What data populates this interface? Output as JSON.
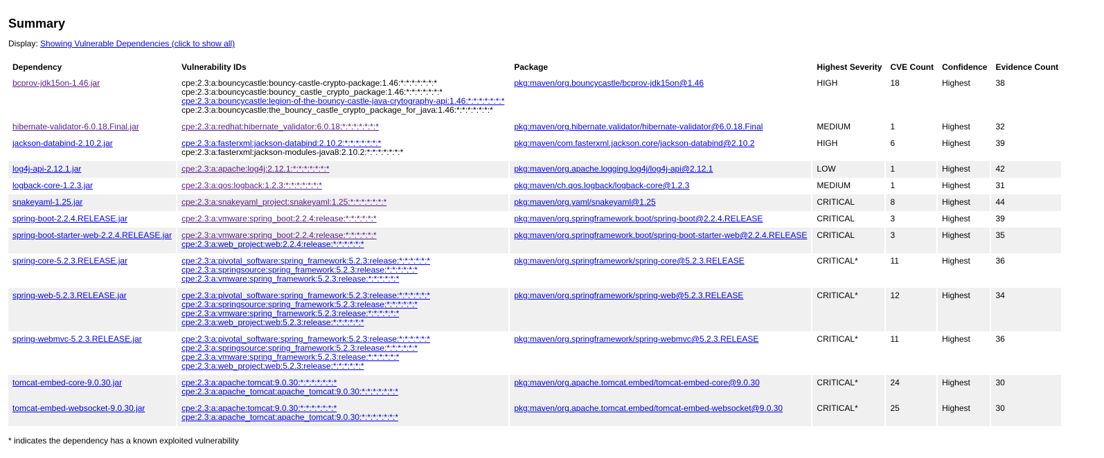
{
  "title": "Summary",
  "display": {
    "label": "Display:",
    "link": "Showing Vulnerable Dependencies (click to show all)"
  },
  "table": {
    "headers": [
      "Dependency",
      "Vulnerability IDs",
      "Package",
      "Highest Severity",
      "CVE Count",
      "Confidence",
      "Evidence Count"
    ],
    "rows": [
      {
        "dependency": "bcprov-jdk15on-1.46.jar",
        "visited": true,
        "ids": [
          {
            "text": "cpe:2.3:a:bouncycastle:bouncy-castle-crypto-package:1.46:*:*:*:*:*:*:*",
            "link": false
          },
          {
            "text": "cpe:2.3:a:bouncycastle:bouncy_castle_crypto_package:1.46:*:*:*:*:*:*:*",
            "link": false
          },
          {
            "text": "cpe:2.3:a:bouncycastle:legion-of-the-bouncy-castle-java-crytography-api:1.46:*:*:*:*:*:*:*",
            "link": true
          },
          {
            "text": "cpe:2.3:a:bouncycastle:the_bouncy_castle_crypto_package_for_java:1.46:*:*:*:*:*:*:*",
            "link": false
          }
        ],
        "package": "pkg:maven/org.bouncycastle/bcprov-jdk15on@1.46",
        "severity": "HIGH",
        "cve_count": "18",
        "confidence": "Highest",
        "evidence_count": "38"
      },
      {
        "dependency": "hibernate-validator-6.0.18.Final.jar",
        "visited": true,
        "ids": [
          {
            "text": "cpe:2.3:a:redhat:hibernate_validator:6.0.18:*:*:*:*:*:*:*",
            "link": true,
            "visited": true
          }
        ],
        "package": "pkg:maven/org.hibernate.validator/hibernate-validator@6.0.18.Final",
        "severity": "MEDIUM",
        "cve_count": "1",
        "confidence": "Highest",
        "evidence_count": "32"
      },
      {
        "dependency": "jackson-databind-2.10.2.jar",
        "ids": [
          {
            "text": "cpe:2.3:a:fasterxml:jackson-databind:2.10.2:*:*:*:*:*:*:*",
            "link": true
          },
          {
            "text": "cpe:2.3:a:fasterxml:jackson-modules-java8:2.10.2:*:*:*:*:*:*:*",
            "link": false
          }
        ],
        "package": "pkg:maven/com.fasterxml.jackson.core/jackson-databind@2.10.2",
        "severity": "HIGH",
        "cve_count": "6",
        "confidence": "Highest",
        "evidence_count": "39"
      },
      {
        "dependency": "log4j-api-2.12.1.jar",
        "ids": [
          {
            "text": "cpe:2.3:a:apache:log4j:2.12.1:*:*:*:*:*:*:*",
            "link": true,
            "visited": true
          }
        ],
        "package": "pkg:maven/org.apache.logging.log4j/log4j-api@2.12.1",
        "severity": "LOW",
        "cve_count": "1",
        "confidence": "Highest",
        "evidence_count": "42"
      },
      {
        "dependency": "logback-core-1.2.3.jar",
        "ids": [
          {
            "text": "cpe:2.3:a:qos:logback:1.2.3:*:*:*:*:*:*:*",
            "link": true,
            "visited": true
          }
        ],
        "package": "pkg:maven/ch.qos.logback/logback-core@1.2.3",
        "severity": "MEDIUM",
        "cve_count": "1",
        "confidence": "Highest",
        "evidence_count": "31"
      },
      {
        "dependency": "snakeyaml-1.25.jar",
        "ids": [
          {
            "text": "cpe:2.3:a:snakeyaml_project:snakeyaml:1.25:*:*:*:*:*:*:*",
            "link": true,
            "visited": true
          }
        ],
        "package": "pkg:maven/org.yaml/snakeyaml@1.25",
        "severity": "CRITICAL",
        "cve_count": "8",
        "confidence": "Highest",
        "evidence_count": "44"
      },
      {
        "dependency": "spring-boot-2.2.4.RELEASE.jar",
        "ids": [
          {
            "text": "cpe:2.3:a:vmware:spring_boot:2.2.4:release:*:*:*:*:*:*",
            "link": true,
            "visited": true
          }
        ],
        "package": "pkg:maven/org.springframework.boot/spring-boot@2.2.4.RELEASE",
        "severity": "CRITICAL",
        "cve_count": "3",
        "confidence": "Highest",
        "evidence_count": "39"
      },
      {
        "dependency": "spring-boot-starter-web-2.2.4.RELEASE.jar",
        "ids": [
          {
            "text": "cpe:2.3:a:vmware:spring_boot:2.2.4:release:*:*:*:*:*:*",
            "link": true,
            "visited": true
          },
          {
            "text": "cpe:2.3:a:web_project:web:2.2.4:release:*:*:*:*:*:*",
            "link": true
          }
        ],
        "package": "pkg:maven/org.springframework.boot/spring-boot-starter-web@2.2.4.RELEASE",
        "severity": "CRITICAL",
        "cve_count": "3",
        "confidence": "Highest",
        "evidence_count": "35"
      },
      {
        "dependency": "spring-core-5.2.3.RELEASE.jar",
        "ids": [
          {
            "text": "cpe:2.3:a:pivotal_software:spring_framework:5.2.3:release:*:*:*:*:*:*",
            "link": true
          },
          {
            "text": "cpe:2.3:a:springsource:spring_framework:5.2.3:release:*:*:*:*:*:*",
            "link": true
          },
          {
            "text": "cpe:2.3:a:vmware:spring_framework:5.2.3:release:*:*:*:*:*:*",
            "link": true
          }
        ],
        "package": "pkg:maven/org.springframework/spring-core@5.2.3.RELEASE",
        "severity": "CRITICAL*",
        "cve_count": "11",
        "confidence": "Highest",
        "evidence_count": "36"
      },
      {
        "dependency": "spring-web-5.2.3.RELEASE.jar",
        "ids": [
          {
            "text": "cpe:2.3:a:pivotal_software:spring_framework:5.2.3:release:*:*:*:*:*:*",
            "link": true
          },
          {
            "text": "cpe:2.3:a:springsource:spring_framework:5.2.3:release:*:*:*:*:*:*",
            "link": true
          },
          {
            "text": "cpe:2.3:a:vmware:spring_framework:5.2.3:release:*:*:*:*:*:*",
            "link": true
          },
          {
            "text": "cpe:2.3:a:web_project:web:5.2.3:release:*:*:*:*:*:*",
            "link": true
          }
        ],
        "package": "pkg:maven/org.springframework/spring-web@5.2.3.RELEASE",
        "severity": "CRITICAL*",
        "cve_count": "12",
        "confidence": "Highest",
        "evidence_count": "34"
      },
      {
        "dependency": "spring-webmvc-5.2.3.RELEASE.jar",
        "ids": [
          {
            "text": "cpe:2.3:a:pivotal_software:spring_framework:5.2.3:release:*:*:*:*:*:*",
            "link": true
          },
          {
            "text": "cpe:2.3:a:springsource:spring_framework:5.2.3:release:*:*:*:*:*:*",
            "link": true
          },
          {
            "text": "cpe:2.3:a:vmware:spring_framework:5.2.3:release:*:*:*:*:*:*",
            "link": true
          },
          {
            "text": "cpe:2.3:a:web_project:web:5.2.3:release:*:*:*:*:*:*",
            "link": true
          }
        ],
        "package": "pkg:maven/org.springframework/spring-webmvc@5.2.3.RELEASE",
        "severity": "CRITICAL*",
        "cve_count": "11",
        "confidence": "Highest",
        "evidence_count": "36"
      },
      {
        "dependency": "tomcat-embed-core-9.0.30.jar",
        "ids": [
          {
            "text": "cpe:2.3:a:apache:tomcat:9.0.30:*:*:*:*:*:*:*",
            "link": true
          },
          {
            "text": "cpe:2.3:a:apache_tomcat:apache_tomcat:9.0.30:*:*:*:*:*:*:*",
            "link": true
          }
        ],
        "package": "pkg:maven/org.apache.tomcat.embed/tomcat-embed-core@9.0.30",
        "severity": "CRITICAL*",
        "cve_count": "24",
        "confidence": "Highest",
        "evidence_count": "30"
      },
      {
        "dependency": "tomcat-embed-websocket-9.0.30.jar",
        "ids": [
          {
            "text": "cpe:2.3:a:apache:tomcat:9.0.30:*:*:*:*:*:*:*",
            "link": true
          },
          {
            "text": "cpe:2.3:a:apache_tomcat:apache_tomcat:9.0.30:*:*:*:*:*:*:*",
            "link": true
          }
        ],
        "package": "pkg:maven/org.apache.tomcat.embed/tomcat-embed-websocket@9.0.30",
        "severity": "CRITICAL*",
        "cve_count": "25",
        "confidence": "Highest",
        "evidence_count": "30"
      }
    ]
  },
  "footnote": "* indicates the dependency has a known exploited vulnerability"
}
